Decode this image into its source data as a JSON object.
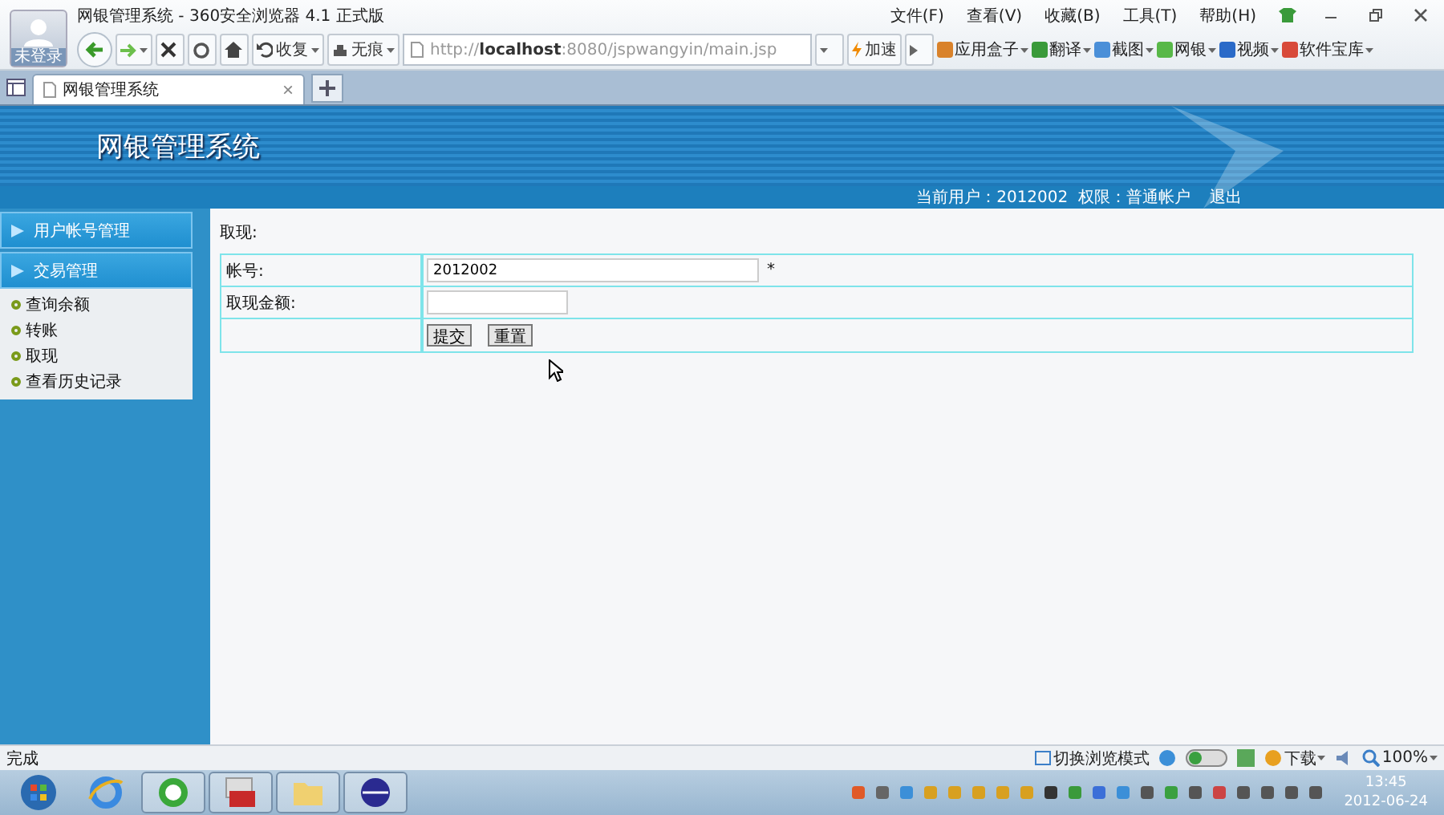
{
  "browser": {
    "title": "网银管理系统 - 360安全浏览器 4.1 正式版",
    "avatar_label": "未登录",
    "menu": [
      "文件(F)",
      "查看(V)",
      "收藏(B)",
      "工具(T)",
      "帮助(H)"
    ],
    "nav_buttons": [
      {
        "label": "收复",
        "kind": "undo"
      },
      {
        "label": "无痕",
        "kind": "incognito"
      }
    ],
    "url": {
      "scheme": "http://",
      "host": "localhost",
      "rest": ":8080/jspwangyin/main.jsp"
    },
    "accelerate": "加速",
    "toolbar": [
      {
        "label": "应用盒子",
        "color": "#d9822b"
      },
      {
        "label": "翻译",
        "color": "#3a9a3a"
      },
      {
        "label": "截图",
        "color": "#4a8fd8"
      },
      {
        "label": "网银",
        "color": "#58b848"
      },
      {
        "label": "视频",
        "color": "#2a6ac8"
      },
      {
        "label": "软件宝库",
        "color": "#d84a3a"
      }
    ],
    "tab": {
      "label": "网银管理系统",
      "close": "×"
    },
    "status": "完成",
    "status_right": {
      "mode": "切换浏览模式",
      "download": "下载",
      "zoom": "100%"
    }
  },
  "app": {
    "title": "网银管理系统",
    "user_info": "当前用户：2012002  权限：普通帐户",
    "logout": "退出",
    "sidebar": [
      {
        "label": "用户帐号管理"
      },
      {
        "label": "交易管理",
        "children": [
          "查询余额",
          "转账",
          "取现",
          "查看历史记录"
        ]
      }
    ],
    "heading": "取现:",
    "rows": [
      {
        "kind": "field",
        "label": "帐号:",
        "value": "2012002",
        "required": "*"
      },
      {
        "kind": "field",
        "label": "取现金额:",
        "value": ""
      },
      {
        "kind": "buttons",
        "buttons": [
          "提交",
          "重置"
        ]
      }
    ]
  },
  "taskbar": {
    "time": "13:45",
    "date": "2012-06-24"
  }
}
